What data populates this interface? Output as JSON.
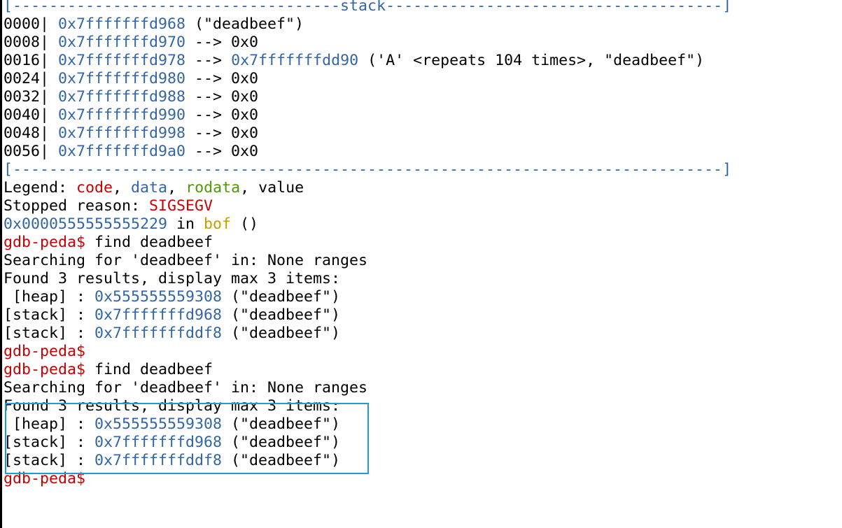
{
  "stack_header": {
    "open": "[",
    "left_dashes": "------------------------------------",
    "label": "stack",
    "right_dashes": "-------------------------------------",
    "close": "]"
  },
  "stack_rows": [
    {
      "offset": "0000|",
      "addr": "0x7fffffffd968",
      "rest": " (\"deadbeef\")"
    },
    {
      "offset": "0008|",
      "addr": "0x7fffffffd970",
      "rest": " --> 0x0"
    },
    {
      "offset": "0016|",
      "addr": "0x7fffffffd978",
      "rest": " --> ",
      "target": "0x7fffffffdd90",
      "rest2": " ('A' <repeats 104 times>, \"deadbeef\")"
    },
    {
      "offset": "0024|",
      "addr": "0x7fffffffd980",
      "rest": " --> 0x0"
    },
    {
      "offset": "0032|",
      "addr": "0x7fffffffd988",
      "rest": " --> 0x0"
    },
    {
      "offset": "0040|",
      "addr": "0x7fffffffd990",
      "rest": " --> 0x0"
    },
    {
      "offset": "0048|",
      "addr": "0x7fffffffd998",
      "rest": " --> 0x0"
    },
    {
      "offset": "0056|",
      "addr": "0x7fffffffd9a0",
      "rest": " --> 0x0"
    }
  ],
  "footer_rule": {
    "open": "[",
    "dashes": "------------------------------------------------------------------------------",
    "close": "]"
  },
  "legend": {
    "prefix": "Legend: ",
    "code": "code",
    "sep1": ", ",
    "data": "data",
    "sep2": ", ",
    "rodata": "rodata",
    "sep3": ", ",
    "value": "value"
  },
  "stopped": {
    "prefix": "Stopped reason: ",
    "reason": "SIGSEGV"
  },
  "location": {
    "addr": "0x0000555555555229",
    "in": " in ",
    "func": "bof",
    "suffix": " ()"
  },
  "prompt": "gdb-peda$",
  "command": " find deadbeef",
  "searching": "Searching for 'deadbeef' in: None ranges",
  "found": "Found 3 results, display max 3 items:",
  "results": [
    {
      "label": " [heap] : ",
      "addr": "0x555555559308",
      "value": " (\"deadbeef\")"
    },
    {
      "label": "[stack] : ",
      "addr": "0x7fffffffd968",
      "value": " (\"deadbeef\")"
    },
    {
      "label": "[stack] : ",
      "addr": "0x7fffffffddf8",
      "value": " (\"deadbeef\")"
    }
  ],
  "colors": {
    "address": "#3465a4",
    "code": "#cc0000",
    "rodata": "#4e9a06",
    "func": "#c4a000",
    "highlight": "#1e9bd7"
  }
}
